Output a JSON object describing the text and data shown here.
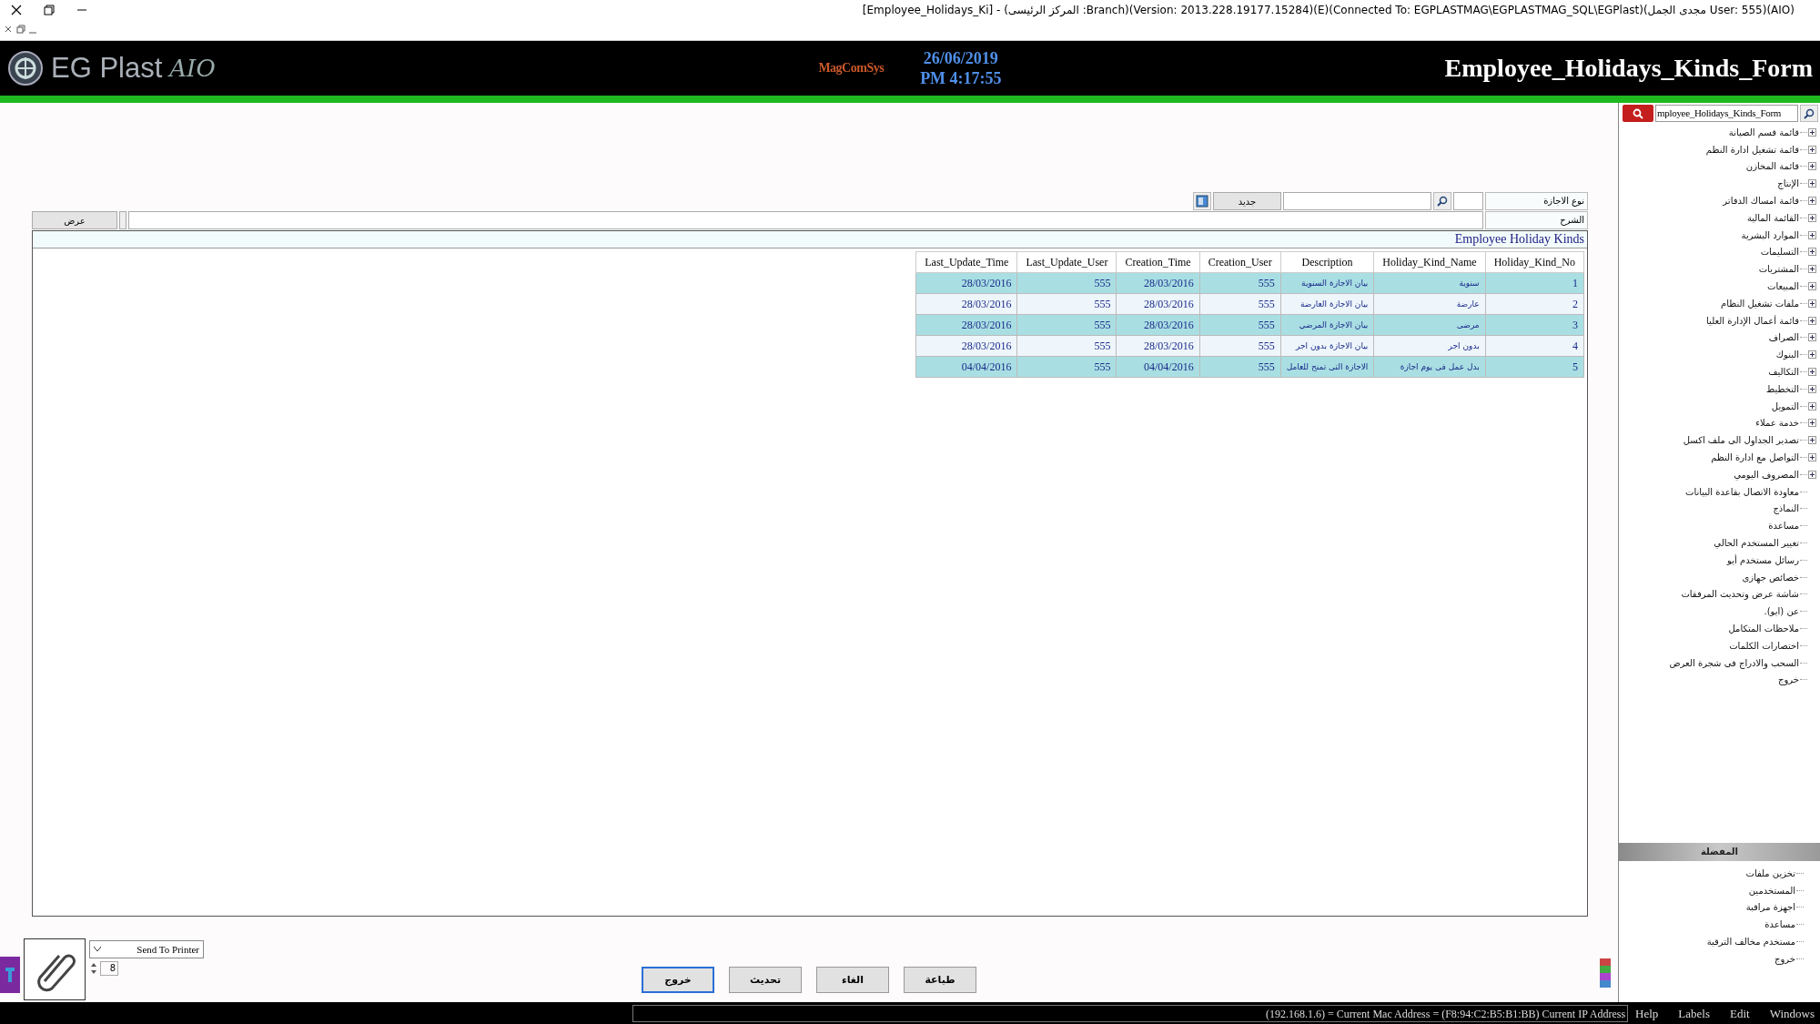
{
  "window": {
    "title": "[Employee_Holidays_Ki] - (المركز الرئيسى :Branch)(Version: 2013.228.19177.15284)(E)(Connected To: EGPLASTMAG\\EGPLASTMAG_SQL\\EGPlast)(مجدى الجمل User: 555)(AIO)"
  },
  "header": {
    "logo_text": "EG Plast",
    "logo_mark": "AIO",
    "brand": "MagComSys",
    "date": "26/06/2019",
    "time": "PM 4:17:55",
    "form_title": "Employee_Holidays_Kinds_Form"
  },
  "form": {
    "fields": [
      {
        "label": "نوع الاجازة"
      },
      {
        "label": "الشرح"
      }
    ],
    "new_button": "جديد",
    "show_button": "عرض"
  },
  "grid": {
    "title": "Employee Holiday Kinds",
    "columns": [
      "Holiday_Kind_No",
      "Holiday_Kind_Name",
      "Description",
      "Creation_User",
      "Creation_Time",
      "Last_Update_User",
      "Last_Update_Time"
    ],
    "rows": [
      [
        "1",
        "سنوية",
        "بيان الاجازة السنوية",
        "555",
        "28/03/2016",
        "555",
        "28/03/2016"
      ],
      [
        "2",
        "عارضة",
        "بيان الاجازة العارضة",
        "555",
        "28/03/2016",
        "555",
        "28/03/2016"
      ],
      [
        "3",
        "مرضى",
        "بيان الاجازة المرضي",
        "555",
        "28/03/2016",
        "555",
        "28/03/2016"
      ],
      [
        "4",
        "بدون اجر",
        "بيان الاجازة بدون اجر",
        "555",
        "28/03/2016",
        "555",
        "28/03/2016"
      ],
      [
        "5",
        "بدل عمل فى يوم اجازة",
        "الاجازة التى تمنح للعامل",
        "555",
        "04/04/2016",
        "555",
        "04/04/2016"
      ]
    ]
  },
  "bottom": {
    "printer": "Send To Printer",
    "copies": "8",
    "buttons": [
      "طباعة",
      "الغاء",
      "تحديث",
      "خروج"
    ]
  },
  "sidebar": {
    "search_value": "mployee_Holidays_Kinds_Form",
    "tree": [
      {
        "label": "قائمة قسم الصيانة",
        "has_children": true
      },
      {
        "label": "قائمة تشغيل ادارة النظم",
        "has_children": true
      },
      {
        "label": "قائمة المخازن",
        "has_children": true
      },
      {
        "label": "الإنتاج",
        "has_children": true
      },
      {
        "label": "قائمة امساك الدفاتر",
        "has_children": true
      },
      {
        "label": "القائمة المالية",
        "has_children": true
      },
      {
        "label": "الموارد البشرية",
        "has_children": true
      },
      {
        "label": "التسليمات",
        "has_children": true
      },
      {
        "label": "المشتريات",
        "has_children": true
      },
      {
        "label": "المبيعات",
        "has_children": true
      },
      {
        "label": "ملفات تشغيل النظام",
        "has_children": true
      },
      {
        "label": "قائمة أعمال الإدارة العليا",
        "has_children": true
      },
      {
        "label": "الصراف",
        "has_children": true
      },
      {
        "label": "البنوك",
        "has_children": true
      },
      {
        "label": "التكاليف",
        "has_children": true
      },
      {
        "label": "التخطيط",
        "has_children": true
      },
      {
        "label": "التمويل",
        "has_children": true
      },
      {
        "label": "خدمة عملاء",
        "has_children": true
      },
      {
        "label": "تصدير الجداول الى ملف اكسل",
        "has_children": true
      },
      {
        "label": "التواصل مع ادارة النظم",
        "has_children": true
      },
      {
        "label": "المصروف اليومي",
        "has_children": true
      },
      {
        "label": "معاودة الاتصال بقاعدة البيانات",
        "has_children": false
      },
      {
        "label": "النماذج",
        "has_children": false
      },
      {
        "label": "مساعدة",
        "has_children": false
      },
      {
        "label": "تغيير المستخدم الحالي",
        "has_children": false
      },
      {
        "label": "رسائل مستخدم أيو",
        "has_children": false
      },
      {
        "label": "خصائص جهازى",
        "has_children": false
      },
      {
        "label": "شاشة عرض وتحديث المرفقات",
        "has_children": false
      },
      {
        "label": "عن (ايو).",
        "has_children": false
      },
      {
        "label": "ملاحظات المتكامل",
        "has_children": false
      },
      {
        "label": "اختصارات الكلمات",
        "has_children": false
      },
      {
        "label": "السحب والادراج فى شجرة العرض",
        "has_children": false
      },
      {
        "label": "خروج",
        "has_children": false
      }
    ],
    "favorites_title": "المفضلة",
    "favorites": [
      "تخزين ملفات",
      "المستخدمين",
      "اجهزة مراقبة",
      "مساعدة",
      "مستخدم مخالف الترقية",
      "خروج"
    ]
  },
  "status_bar": {
    "text": "(192.168.1.6) = Current Mac Address = (F8:94:C2:B5:B1:BB) Current IP Address",
    "menus": [
      "Windows",
      "Edit",
      "Labels",
      "Help"
    ]
  }
}
